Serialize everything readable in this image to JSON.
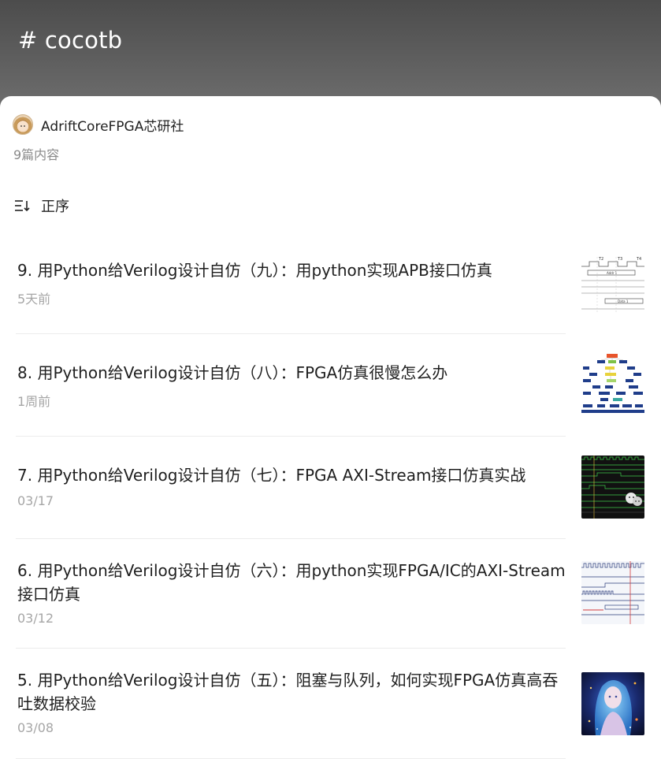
{
  "header": {
    "title": "# cocotb"
  },
  "author": {
    "name": "AdriftCoreFPGA芯研社",
    "avatar": "avatar-image"
  },
  "post_count": "9篇内容",
  "sort": {
    "label": "正序",
    "icon": "sort-order-icon"
  },
  "items": [
    {
      "title": "9. 用Python给Verilog设计自仿（九）：用python实现APB接口仿真",
      "time": "5天前",
      "thumb": "timing-diagram-thumbnail"
    },
    {
      "title": "8. 用Python给Verilog设计自仿（八）：FPGA仿真很慢怎么办",
      "time": "1周前",
      "thumb": "block-diagram-thumbnail"
    },
    {
      "title": "7. 用Python给Verilog设计自仿（七）：FPGA AXI-Stream接口仿真实战",
      "time": "03/17",
      "thumb": "waveform-thumbnail"
    },
    {
      "title": "6. 用Python给Verilog设计自仿（六）：用python实现FPGA/IC的AXI-Stream接口仿真",
      "time": "03/12",
      "thumb": "waveform-light-thumbnail"
    },
    {
      "title": "5. 用Python给Verilog设计自仿（五）：阻塞与队列，如何实现FPGA仿真高吞吐数据校验",
      "time": "03/08",
      "thumb": "illustration-thumbnail"
    }
  ]
}
